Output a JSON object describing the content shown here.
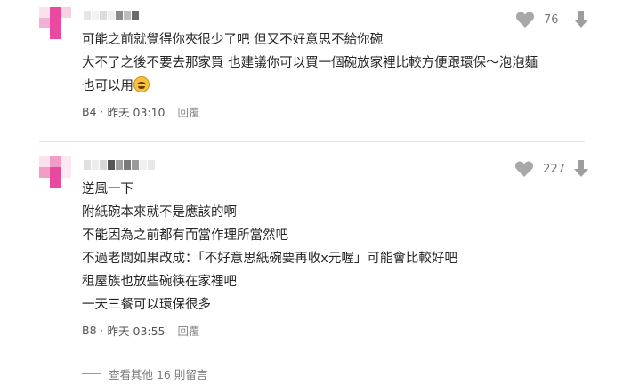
{
  "comments": [
    {
      "likes": "76",
      "lines": [
        "可能之前就覺得你夾很少了吧 但又不好意思不給你碗",
        "大不了之後不要去那家買 也建議你可以買一個碗放家裡比較方便跟環保～泡泡麵",
        "也可以用"
      ],
      "floor": "B4",
      "time": "昨天 03:10",
      "reply_label": "回覆"
    },
    {
      "likes": "227",
      "lines": [
        "逆風一下",
        "附紙碗本來就不是應該的啊",
        "不能因為之前都有而當作理所當然吧",
        "不過老闆如果改成：「不好意思紙碗要再收x元喔」可能會比較好吧",
        "租屋族也放些碗筷在家裡吧",
        "一天三餐可以環保很多"
      ],
      "floor": "B8",
      "time": "昨天 03:55",
      "reply_label": "回覆"
    }
  ],
  "more_replies_label": "查看其他 16 則留言",
  "icons": {
    "like": "heart-icon",
    "dislike": "down-arrow-icon",
    "emoji": "laughing-emoji-icon"
  },
  "colors": {
    "avatar_pink": "#e94aa0",
    "avatar_light_pink": "#f6c3dc",
    "icon_gray": "#a8a8a8"
  }
}
